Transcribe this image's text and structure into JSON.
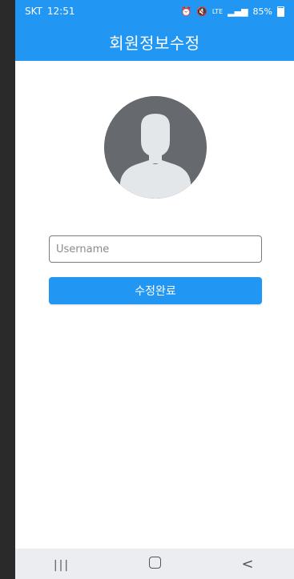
{
  "status_bar": {
    "carrier": "SKT",
    "time": "12:51",
    "icons": [
      "alarm-icon",
      "mute-icon",
      "lte-icon",
      "signal-icon"
    ],
    "battery": "85%"
  },
  "app_bar": {
    "title": "회원정보수정"
  },
  "profile": {
    "avatar_icon": "person-silhouette-icon"
  },
  "form": {
    "username_placeholder": "Username",
    "username_value": "",
    "submit_label": "수정완료"
  },
  "nav_bar": {
    "recent_label": "|||",
    "back_label": "<"
  },
  "colors": {
    "primary": "#2196F3",
    "avatar_bg": "#666a6e",
    "nav_bg": "#ecedf0"
  }
}
